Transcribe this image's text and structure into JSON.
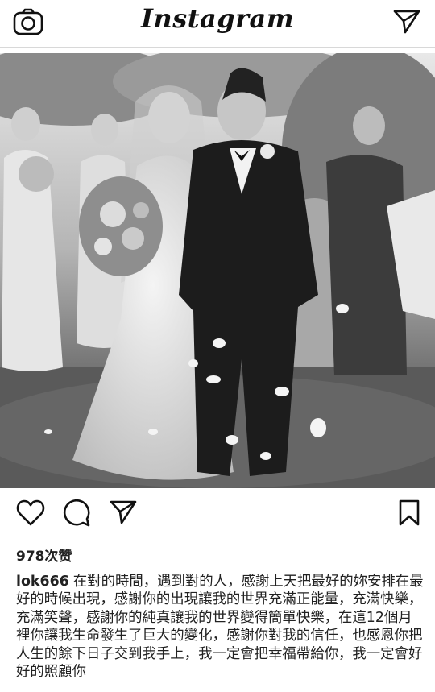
{
  "app": {
    "title": "Instagram"
  },
  "header": {
    "camera_icon": "camera-icon",
    "direct_icon": "paper-plane-icon"
  },
  "post": {
    "photo_alt": "wedding-photo",
    "actions": [
      "heart-icon",
      "comment-icon",
      "share-icon",
      "bookmark-icon"
    ],
    "likes": "978次赞",
    "caption": {
      "username": "lok666",
      "text": "在對的時間，遇到對的人，感謝上天把最好的妳安排在最好的時候出現，感謝你的出現讓我的世界充滿正能量，充滿快樂，充滿笑聲，感謝你的純真讓我的世界變得簡單快樂，在這12個月裡你讓我生命發生了巨大的變化，感謝你對我的信任，也感恩你把人生的餘下日子交到我手上，我一定會把幸福帶給你，我一定會好好的照顧你"
    }
  },
  "colors": {
    "icon": "#111111",
    "divider": "#d8d8d8"
  }
}
